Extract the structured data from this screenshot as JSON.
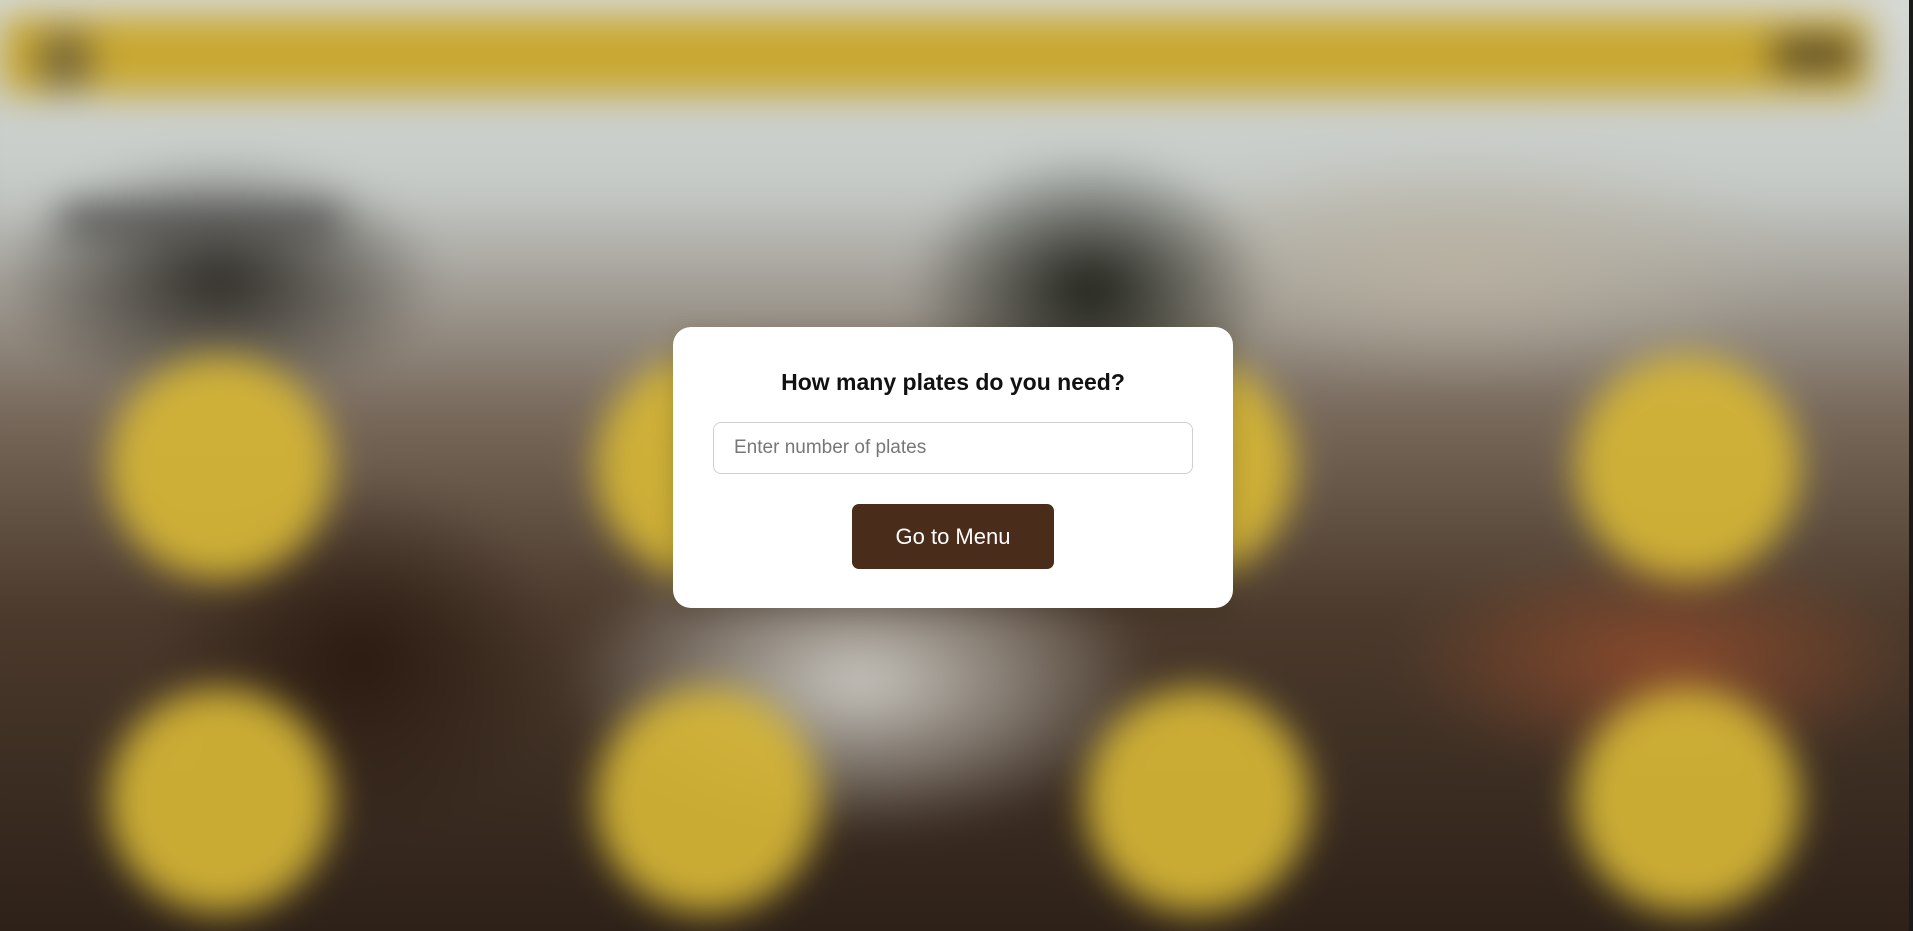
{
  "modal": {
    "title": "How many plates do you need?",
    "input_placeholder": "Enter number of plates",
    "input_value": "",
    "button_label": "Go to Menu"
  },
  "colors": {
    "accent_yellow": "#c9a832",
    "button_brown": "#4a2c1a",
    "modal_background": "#ffffff"
  }
}
